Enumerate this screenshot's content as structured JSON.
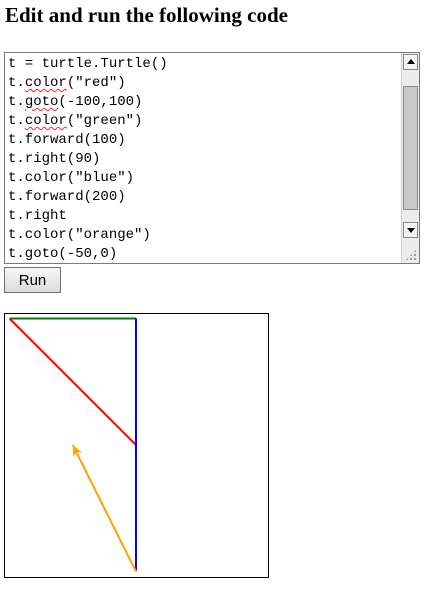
{
  "page": {
    "title": "Edit and run the following code"
  },
  "editor": {
    "lines": [
      "t = turtle.Turtle()",
      "t.color(\"red\")",
      "t.goto(-100,100)",
      "t.color(\"green\")",
      "t.forward(100)",
      "t.right(90)",
      "t.color(\"blue\")",
      "t.forward(200)",
      "t.right",
      "t.color(\"orange\")",
      "t.goto(-50,0)"
    ],
    "spellcheck_words": [
      "goto",
      "color"
    ],
    "scrollbar": {
      "up_icon": "arrow-up-icon",
      "down_icon": "arrow-down-icon",
      "resize_icon": "resize-grip-icon"
    }
  },
  "run_button": {
    "label": "Run"
  },
  "turtle": {
    "start": [
      0,
      0
    ],
    "segments": [
      {
        "color": "#ff0000",
        "from": [
          0,
          0
        ],
        "to": [
          -100,
          100
        ]
      },
      {
        "color": "#008000",
        "from": [
          -100,
          100
        ],
        "to": [
          0,
          100
        ]
      },
      {
        "color": "#0000ff",
        "from": [
          0,
          100
        ],
        "to": [
          0,
          -100
        ]
      },
      {
        "color": "#ffa500",
        "from": [
          0,
          -100
        ],
        "to": [
          -50,
          0
        ]
      }
    ],
    "cursor": {
      "position": [
        -50,
        0
      ],
      "heading_deg": 116.57,
      "color": "#ffa500"
    }
  }
}
